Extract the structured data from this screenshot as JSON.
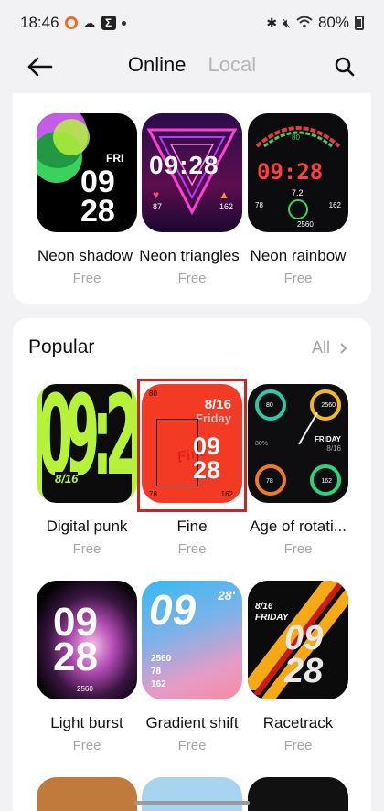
{
  "status_bar": {
    "time": "18:46",
    "battery": "80%"
  },
  "header": {
    "tab_online": "Online",
    "tab_local": "Local"
  },
  "featured": {
    "items": [
      {
        "name": "Neon shadow",
        "price": "Free",
        "face_day": "FRI",
        "face_hour": "09",
        "face_min": "28"
      },
      {
        "name": "Neon triangles",
        "price": "Free",
        "face_time": "09:28",
        "face_left": "87",
        "face_right": "162"
      },
      {
        "name": "Neon rainbow",
        "price": "Free",
        "face_time": "09:28",
        "face_top": "80",
        "face_date": "7.2",
        "face_left": "78",
        "face_right": "162",
        "face_bottom": "2560"
      }
    ]
  },
  "popular": {
    "title": "Popular",
    "all_label": "All",
    "items": [
      {
        "name": "Digital punk",
        "price": "Free",
        "face_time": "09:28",
        "face_date": "8/16"
      },
      {
        "name": "Fine",
        "price": "Free",
        "face_top": "80",
        "face_date": "8/16",
        "face_day": "Friday",
        "face_hour": "09",
        "face_min": "28",
        "face_script": "Fine",
        "face_left": "78",
        "face_right": "162"
      },
      {
        "name": "Age of rotati...",
        "price": "Free",
        "face_tl": "80",
        "face_tr": "2560",
        "face_mid": "80%",
        "face_day": "FRIDAY",
        "face_date": "8/16",
        "face_bl": "78",
        "face_br": "162"
      },
      {
        "name": "Light burst",
        "price": "Free",
        "face_hour": "09",
        "face_min": "28",
        "face_bottom": "2560"
      },
      {
        "name": "Gradient shift",
        "price": "Free",
        "face_hour": "09",
        "face_sec": "28'",
        "face_l1": "2560",
        "face_l2": "78",
        "face_l3": "162"
      },
      {
        "name": "Racetrack",
        "price": "Free",
        "face_date": "8/16",
        "face_day": "FRIDAY",
        "face_hour": "09",
        "face_min": "28"
      }
    ]
  },
  "colors": {
    "accent_red": "#c62828",
    "neon_green": "#b6f23a",
    "fine_red": "#f23a25"
  }
}
